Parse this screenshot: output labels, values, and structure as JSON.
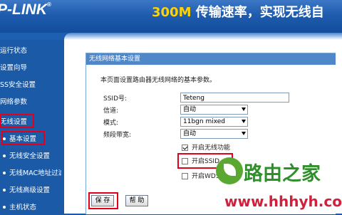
{
  "header": {
    "logo": "P-LINK",
    "logo_mark": "®",
    "slogan_speed": "300M",
    "slogan_text": " 传输速率，实现无线自"
  },
  "sidebar": {
    "items": [
      {
        "label": "运行状态",
        "sub": false
      },
      {
        "label": "设置向导",
        "sub": false
      },
      {
        "label": "SS安全设置",
        "sub": false
      },
      {
        "label": "网络参数",
        "sub": false
      },
      {
        "label": "无线设置",
        "sub": false,
        "highlighted": true
      },
      {
        "label": "基本设置",
        "sub": true,
        "highlighted": true
      },
      {
        "label": "无线安全设置",
        "sub": true
      },
      {
        "label": "无线MAC地址过滤",
        "sub": true
      },
      {
        "label": "无线高级设置",
        "sub": true
      },
      {
        "label": "主机状态",
        "sub": true
      }
    ]
  },
  "panel": {
    "title": "无线网络基本设置",
    "description": "本页面设置路由器无线网络的基本参数。"
  },
  "form": {
    "ssid_label": "SSID号:",
    "ssid_value": "Teteng",
    "channel_label": "信道:",
    "channel_value": "自动",
    "mode_label": "模式:",
    "mode_value": "11bgn mixed",
    "bandwidth_label": "频段带宽:",
    "bandwidth_value": "自动",
    "enable_wireless_label": "开启无线功能",
    "enable_wireless_checked": true,
    "enable_ssid_label": "开启SSID",
    "enable_ssid_checked": false,
    "enable_wds_label": "开启WDS",
    "enable_wds_checked": false
  },
  "buttons": {
    "save": "保 存",
    "help": "帮 助"
  },
  "watermark": {
    "text": "路由之家",
    "url": "www.hhhyh.com"
  },
  "colors": {
    "sidebar_bg": "#1a5aa6",
    "panel_title_bg": "#4f87c9",
    "highlight_red": "#e3001b",
    "watermark_green": "#2f8f2a",
    "watermark_red": "#d11f3c"
  }
}
